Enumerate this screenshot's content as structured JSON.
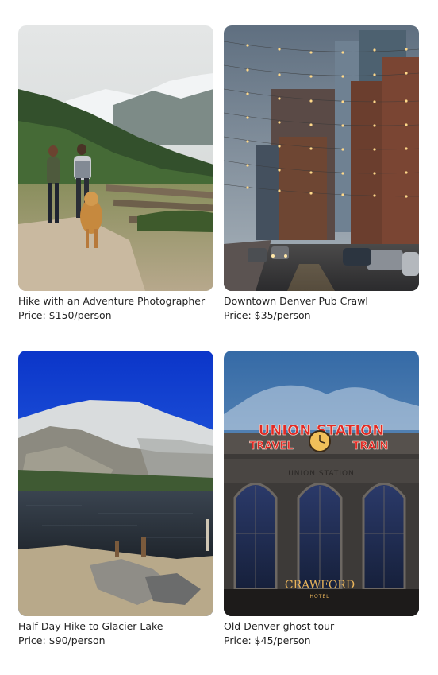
{
  "tours": [
    {
      "title": "Hike with an Adventure Photographer",
      "price": "Price: $150/person",
      "image_subject": "couple-hiking-with-dog"
    },
    {
      "title": "Downtown Denver Pub Crawl",
      "price": "Price: $35/person",
      "image_subject": "city-street-string-lights"
    },
    {
      "title": "Half Day Hike to Glacier Lake",
      "price": "Price: $90/person",
      "image_subject": "mountain-lake"
    },
    {
      "title": "Old Denver ghost tour",
      "price": "Price: $45/person",
      "image_subject": "union-station-facade"
    }
  ],
  "signage": {
    "union_station": "UNION STATION",
    "travel_by_train": "TRAVEL",
    "by_train_end": "TRAIN",
    "facade_engraving": "UNION STATION",
    "crawford": "CRAWFORD",
    "hotel": "HOTEL"
  }
}
